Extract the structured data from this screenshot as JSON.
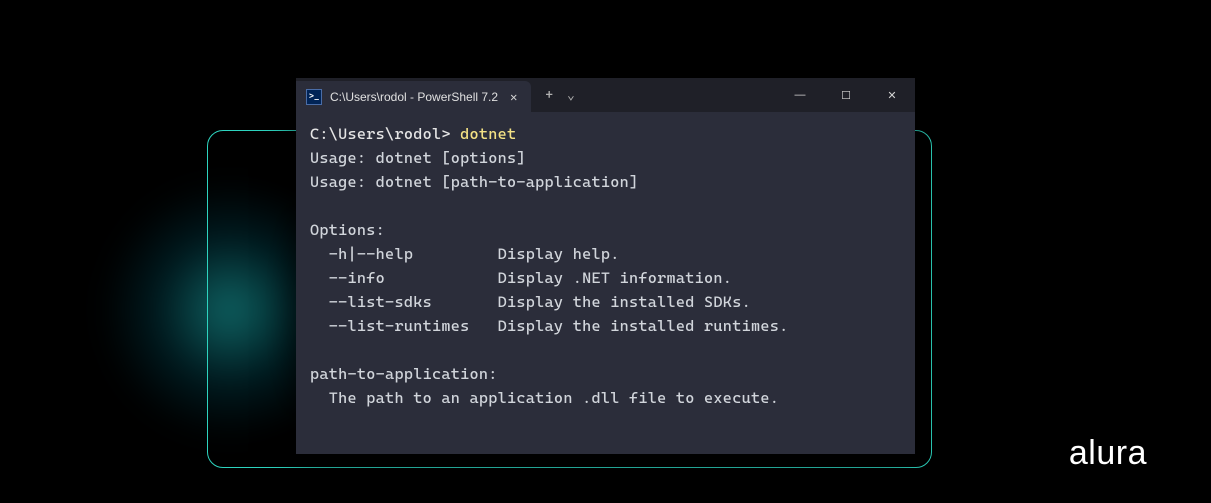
{
  "window": {
    "tab": {
      "icon_label": ">_",
      "title": "C:\\Users\\rodol - PowerShell 7.2"
    },
    "controls": {
      "new_tab": "+",
      "dropdown": "⌄",
      "minimize": "—",
      "maximize": "☐",
      "close": "✕"
    },
    "tab_close": "✕"
  },
  "terminal": {
    "prompt_path": "C:\\Users\\rodol>",
    "prompt_cmd": "dotnet",
    "output": "\nUsage: dotnet [options]\nUsage: dotnet [path-to-application]\n\nOptions:\n  -h|--help         Display help.\n  --info            Display .NET information.\n  --list-sdks       Display the installed SDKs.\n  --list-runtimes   Display the installed runtimes.\n\npath-to-application:\n  The path to an application .dll file to execute."
  },
  "brand": "alura"
}
